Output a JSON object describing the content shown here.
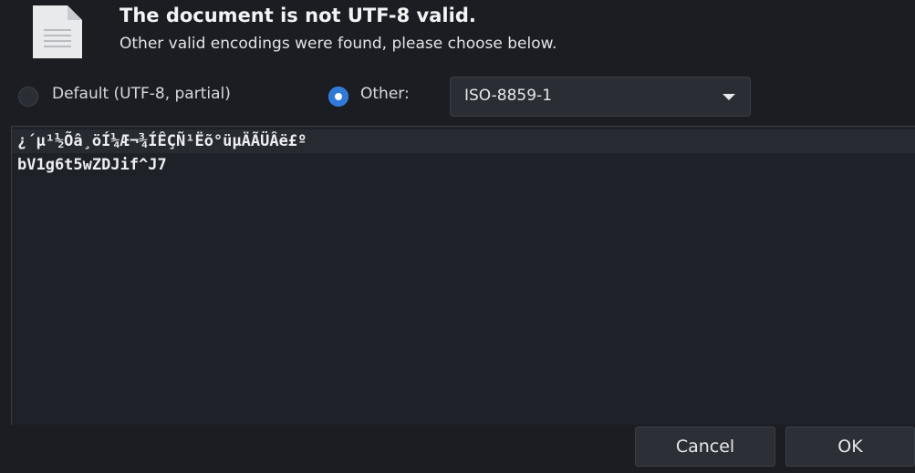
{
  "header": {
    "icon": "document-icon",
    "title": "The document is not UTF-8 valid.",
    "subtitle": "Other valid encodings were found, please choose below."
  },
  "encoding_options": {
    "default_label": "Default (UTF-8, partial)",
    "default_selected": false,
    "other_label": "Other:",
    "other_selected": true,
    "select_value": "ISO-8859-1"
  },
  "preview": {
    "lines": [
      "¿´µ¹½Õâ¸öÍ¼Æ¬¾ÍÊÇÑ¹Ëõ°üµÄÃÜÂë£º",
      "bV1g6t5wZDJif^J7"
    ]
  },
  "footer": {
    "cancel_label": "Cancel",
    "ok_label": "OK"
  },
  "colors": {
    "background": "#1b1d23",
    "accent": "#2f7ad8",
    "text": "#e6e8ec"
  }
}
